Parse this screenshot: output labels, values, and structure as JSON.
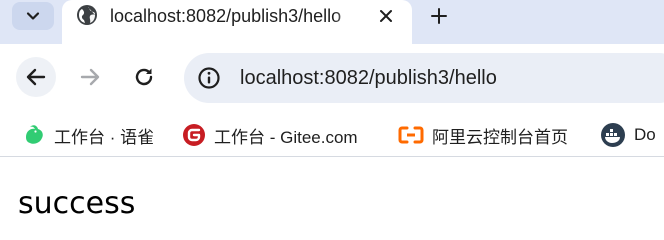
{
  "tabbar": {
    "tab_title": "localhost:8082/publish3/hello",
    "icons": {
      "menu": "chevron-down-icon",
      "favicon": "globe-icon",
      "close": "close-icon",
      "new_tab": "plus-icon"
    }
  },
  "toolbar": {
    "url": "localhost:8082/publish3/hello",
    "icons": {
      "back": "arrow-left-icon",
      "forward": "arrow-right-icon",
      "reload": "reload-icon",
      "site_info": "info-icon"
    }
  },
  "bookmarks": [
    {
      "label": "工作台 · 语雀",
      "icon": "yuque-icon"
    },
    {
      "label": "工作台 - Gitee.com",
      "icon": "gitee-icon"
    },
    {
      "label": "阿里云控制台首页",
      "icon": "aliyun-icon"
    },
    {
      "label": "Do",
      "icon": "docker-icon"
    }
  ],
  "page": {
    "body_text": "success"
  },
  "colors": {
    "tabbar_bg": "#dfe6f6",
    "omnibox_bg": "#eaeef6",
    "gitee_red": "#c71d23",
    "aliyun_orange": "#ff6a00",
    "yuque_green": "#31cc73"
  }
}
